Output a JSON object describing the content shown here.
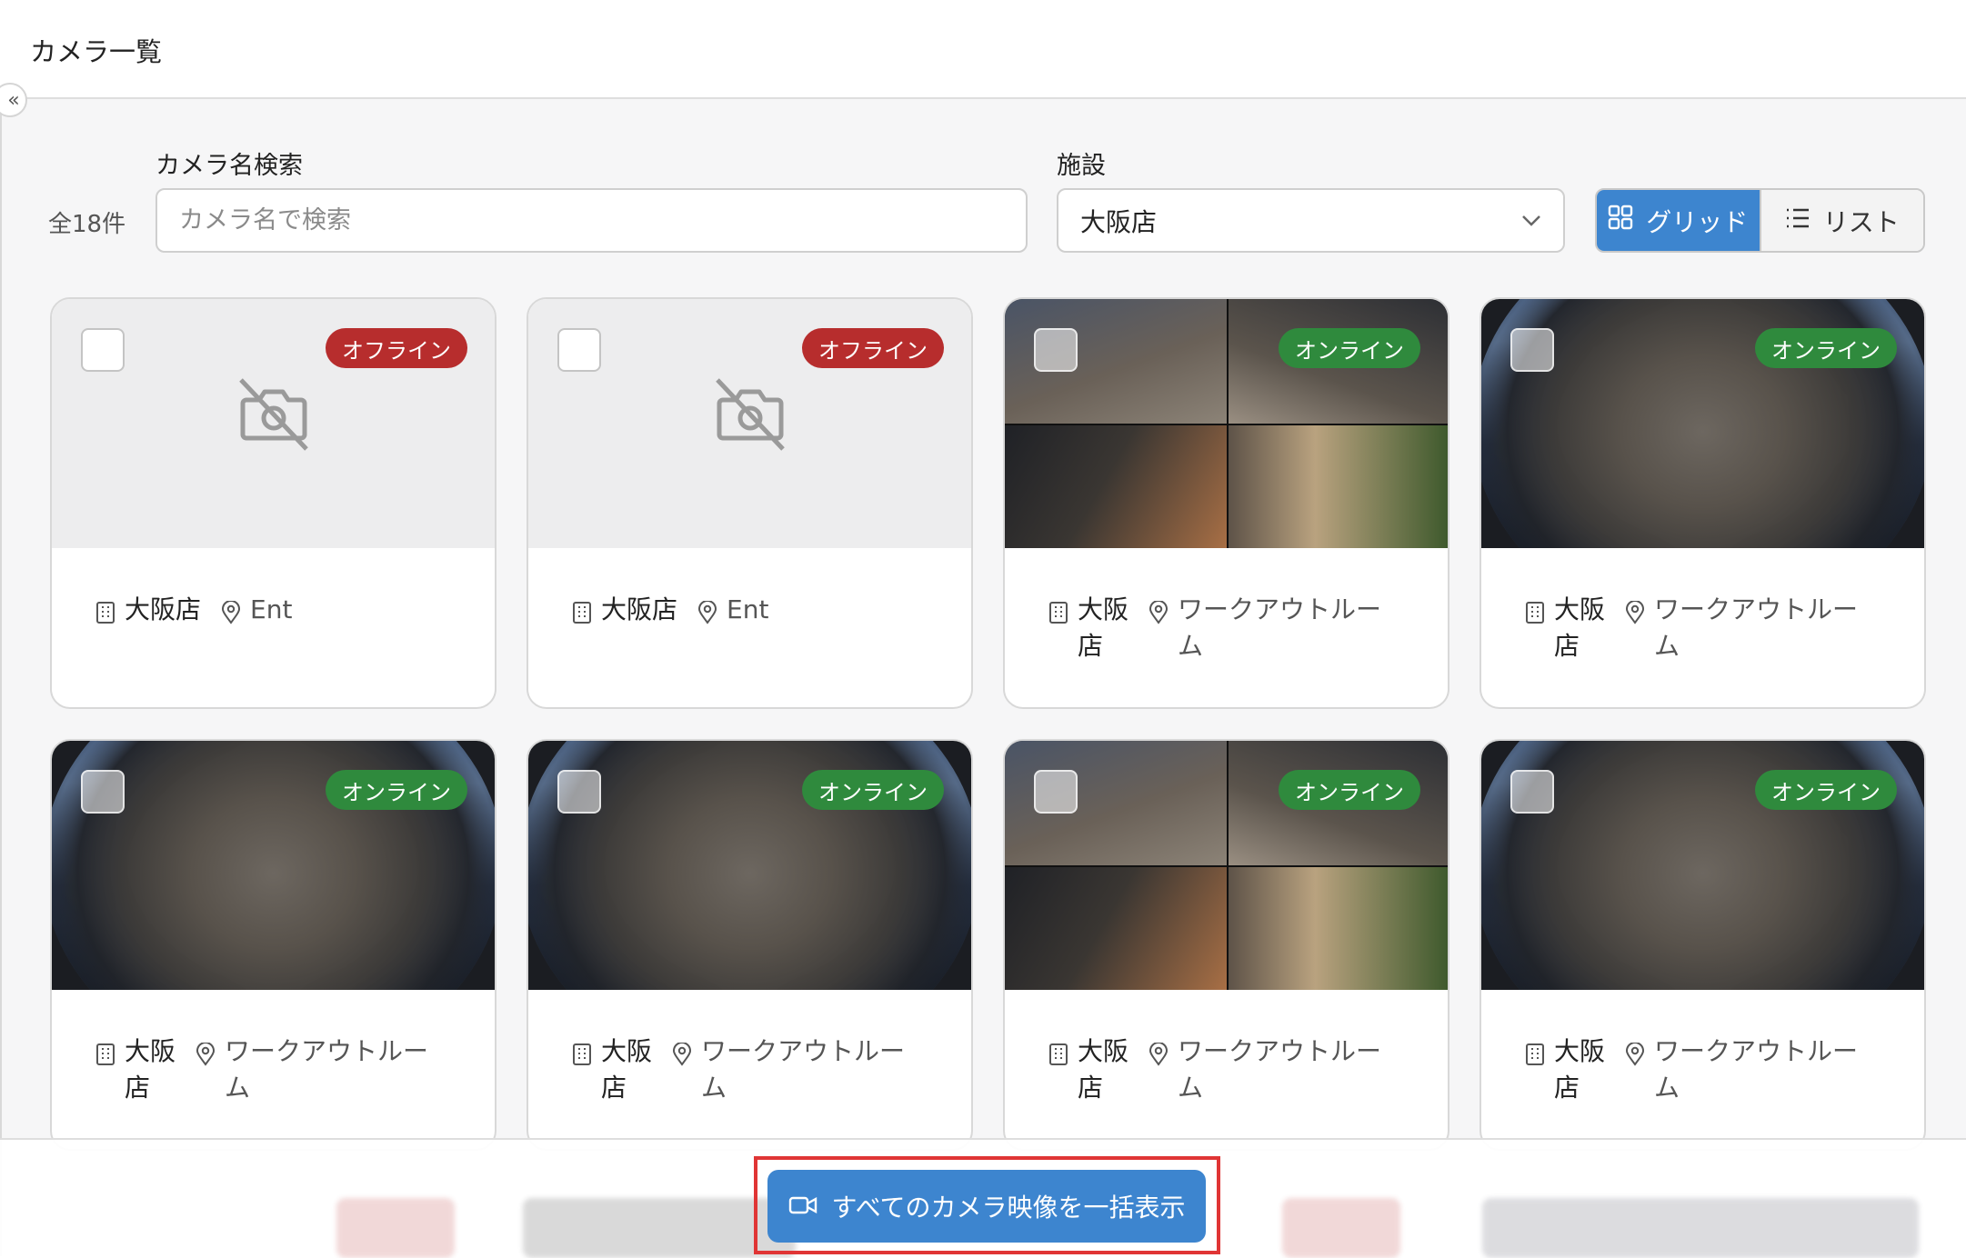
{
  "header": {
    "title": "カメラ一覧",
    "collapse_glyph": "«"
  },
  "filters": {
    "total": "全18件",
    "search_label": "カメラ名検索",
    "search_placeholder": "カメラ名で検索",
    "search_value": "",
    "facility_label": "施設",
    "facility_value": "大阪店"
  },
  "view_toggle": {
    "grid_label": "グリッド",
    "list_label": "リスト",
    "active": "grid"
  },
  "cards": [
    {
      "status": "オフライン",
      "state": "offline",
      "facility": "大阪店",
      "location": "Ent"
    },
    {
      "status": "オフライン",
      "state": "offline",
      "facility": "大阪店",
      "location": "Ent"
    },
    {
      "status": "オンライン",
      "state": "online",
      "view": "split",
      "facility_lines": [
        "大阪",
        "店"
      ],
      "location_lines": [
        "ワークアウトルー",
        "ム"
      ]
    },
    {
      "status": "オンライン",
      "state": "online",
      "view": "fisheye",
      "facility_lines": [
        "大阪",
        "店"
      ],
      "location_lines": [
        "ワークアウトルー",
        "ム"
      ]
    },
    {
      "status": "オンライン",
      "state": "online",
      "view": "fisheye",
      "facility_lines": [
        "大阪",
        "店"
      ],
      "location_lines": [
        "ワークアウトルー",
        "ム"
      ]
    },
    {
      "status": "オンライン",
      "state": "online",
      "view": "fisheye",
      "facility_lines": [
        "大阪",
        "店"
      ],
      "location_lines": [
        "ワークアウトルー",
        "ム"
      ]
    },
    {
      "status": "オンライン",
      "state": "online",
      "view": "split",
      "facility_lines": [
        "大阪",
        "店"
      ],
      "location_lines": [
        "ワークアウトルー",
        "ム"
      ]
    },
    {
      "status": "オンライン",
      "state": "online",
      "view": "fisheye",
      "facility_lines": [
        "大阪",
        "店"
      ],
      "location_lines": [
        "ワークアウトルー",
        "ム"
      ]
    }
  ],
  "footer": {
    "bulk_view_label": "すべてのカメラ映像を一括表示"
  },
  "colors": {
    "accent": "#3d85cf",
    "offline": "#b72d2d",
    "online": "#2f8a3d",
    "highlight": "#e03535"
  }
}
